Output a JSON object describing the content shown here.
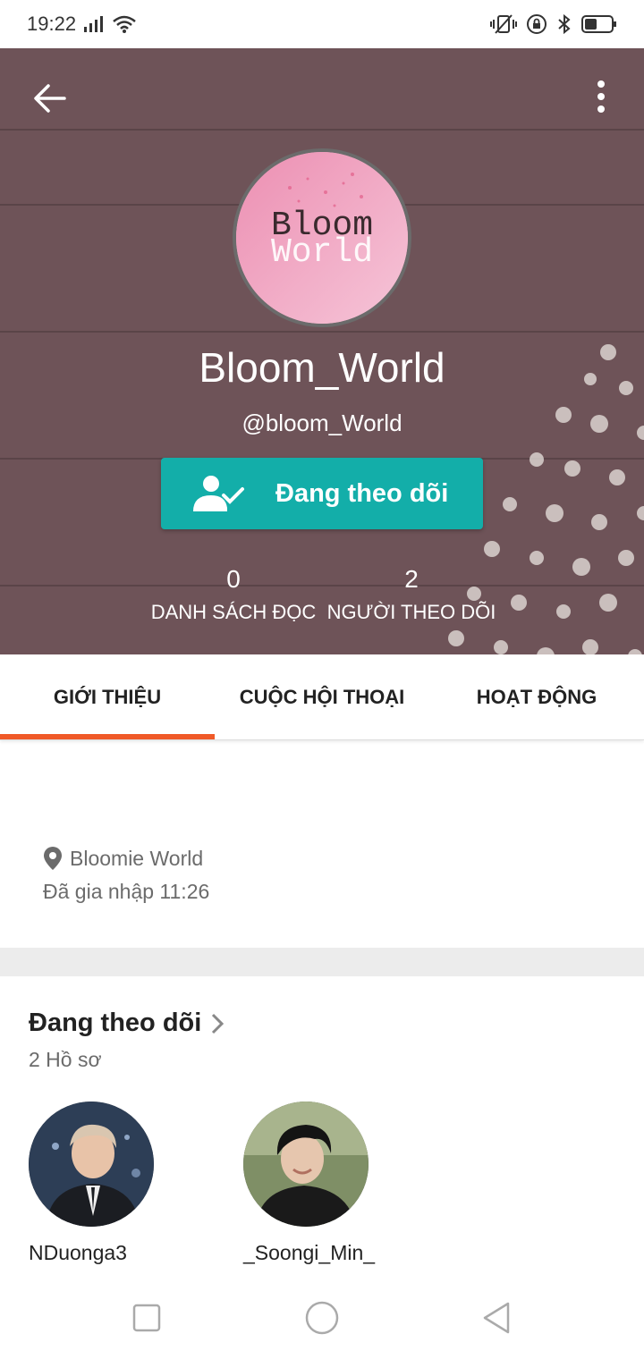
{
  "status_bar": {
    "time": "19:22",
    "icons": [
      "signal-icon",
      "wifi-icon",
      "vibrate-icon",
      "rotation-lock-icon",
      "bluetooth-icon",
      "battery-icon"
    ]
  },
  "profile": {
    "name": "Bloom_World",
    "handle": "@bloom_World",
    "avatar_text_line1": "Bloom",
    "avatar_text_line2": "World",
    "follow_button_label": "Đang theo dõi",
    "stats": [
      {
        "value": "0",
        "label": "DANH SÁCH ĐỌC"
      },
      {
        "value": "2",
        "label": "NGƯỜI THEO DÕI"
      }
    ]
  },
  "tabs": [
    {
      "label": "GIỚI THIỆU",
      "active": true
    },
    {
      "label": "CUỘC HỘI THOẠI",
      "active": false
    },
    {
      "label": "HOẠT ĐỘNG",
      "active": false
    }
  ],
  "about": {
    "location": "Bloomie World",
    "joined": "Đã gia nhập 11:26"
  },
  "following": {
    "title": "Đang theo dõi",
    "count": "2 Hồ sơ",
    "users": [
      {
        "name": "NDuonga3"
      },
      {
        "name": "_Soongi_Min_"
      }
    ]
  },
  "colors": {
    "accent": "#13aea9",
    "tab_indicator": "#f05a28",
    "hero_bg": "#6e5358"
  }
}
